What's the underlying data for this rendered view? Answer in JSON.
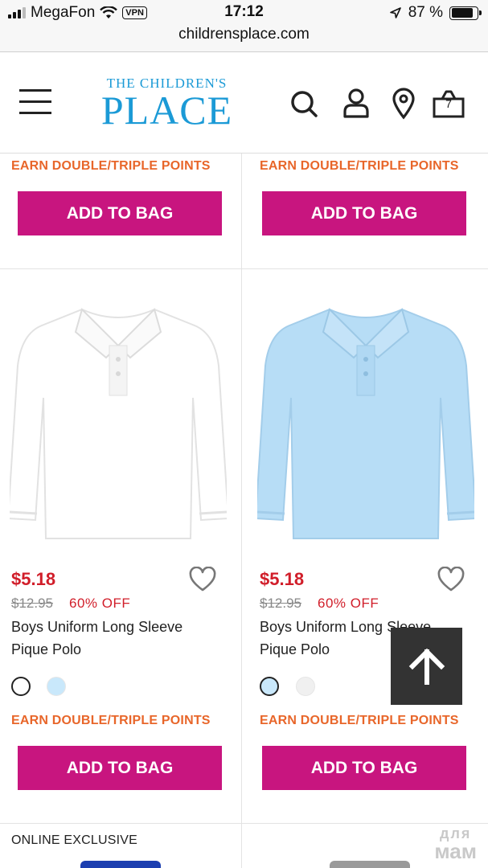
{
  "status_bar": {
    "carrier": "MegaFon",
    "vpn": "VPN",
    "time": "17:12",
    "battery_percent": "87 %",
    "battery_level": 0.87
  },
  "browser": {
    "url": "childrensplace.com"
  },
  "header": {
    "logo_small": "THE CHILDREN'S",
    "logo_big": "PLACE",
    "logo_color": "#1b9ad6",
    "bag_count": "7",
    "icons": [
      "menu-icon",
      "search-icon",
      "account-icon",
      "location-pin-icon",
      "shopping-bag-icon"
    ]
  },
  "top_row": [
    {
      "promo": "EARN DOUBLE/TRIPLE POINTS",
      "button": "ADD TO BAG"
    },
    {
      "promo": "EARN DOUBLE/TRIPLE POINTS",
      "button": "ADD TO BAG"
    }
  ],
  "products": [
    {
      "image": "white-long-sleeve-polo",
      "price": "$5.18",
      "original_price": "$12.95",
      "discount": "60% OFF",
      "name": "Boys Uniform Long Sleeve Pique Polo",
      "swatches": [
        "#ffffff",
        "#c9e8fb"
      ],
      "selected_swatch": 0,
      "promo": "EARN DOUBLE/TRIPLE POINTS",
      "button": "ADD TO BAG"
    },
    {
      "image": "light-blue-long-sleeve-polo",
      "price": "$5.18",
      "original_price": "$12.95",
      "discount": "60% OFF",
      "name": "Boys Uniform Long Sleeve Pique Polo",
      "swatches": [
        "#c9e8fb",
        "#f0f0f0"
      ],
      "selected_swatch": 0,
      "promo": "EARN DOUBLE/TRIPLE POINTS",
      "button": "ADD TO BAG"
    }
  ],
  "bottom_row": {
    "label": "ONLINE EXCLUSIVE"
  },
  "colors": {
    "button": "#c8157f",
    "promo": "#e8662a",
    "price": "#d11e2a"
  },
  "back_to_top_icon": "arrow-up-icon",
  "watermark": {
    "line1": "для",
    "line2": "мам"
  }
}
